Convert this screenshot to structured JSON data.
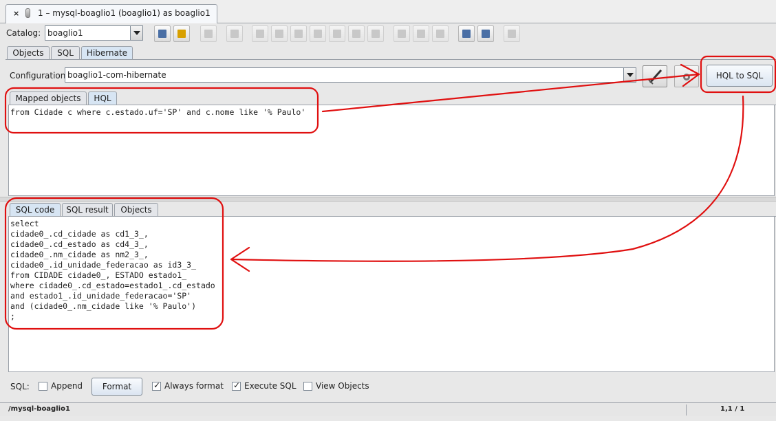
{
  "window": {
    "tab_title": "1 – mysql-boaglio1 (boaglio1) as boaglio1",
    "close_glyph": "×"
  },
  "toolbar": {
    "catalog_label": "Catalog:",
    "catalog_value": "boaglio1"
  },
  "main_tabs": [
    {
      "label": "Objects",
      "selected": false
    },
    {
      "label": "SQL",
      "selected": false
    },
    {
      "label": "Hibernate",
      "selected": true
    }
  ],
  "config": {
    "label": "Configuration",
    "value": "boaglio1-com-hibernate",
    "hql_to_sql_label": "HQL to SQL"
  },
  "hql_tabs": [
    {
      "label": "Mapped objects",
      "selected": false
    },
    {
      "label": "HQL",
      "selected": true
    }
  ],
  "hql_query": "from Cidade c where c.estado.uf='SP' and c.nome like '% Paulo'",
  "sql_tabs": [
    {
      "label": "SQL code",
      "selected": true
    },
    {
      "label": "SQL result",
      "selected": false
    },
    {
      "label": "Objects",
      "selected": false
    }
  ],
  "sql_code": [
    "select",
    "cidade0_.cd_cidade as cd1_3_,",
    "cidade0_.cd_estado as cd4_3_,",
    "cidade0_.nm_cidade as nm2_3_,",
    "cidade0_.id_unidade_federacao as id3_3_",
    "from CIDADE cidade0_, ESTADO estado1_",
    "where cidade0_.cd_estado=estado1_.cd_estado",
    "and estado1_.id_unidade_federacao='SP'",
    "and (cidade0_.nm_cidade like '% Paulo')",
    ";"
  ],
  "options": {
    "sql_label": "SQL:",
    "append": {
      "label": "Append",
      "checked": false
    },
    "format_label": "Format",
    "always_format": {
      "label": "Always format",
      "checked": true
    },
    "execute_sql": {
      "label": "Execute SQL",
      "checked": true
    },
    "view_objects": {
      "label": "View Objects",
      "checked": false
    }
  },
  "status": {
    "connection": "/mysql-boaglio1",
    "position": "1,1 / 1"
  },
  "colors": {
    "annotation_red": "#e01010",
    "selected_tab": "#d7e5f3"
  },
  "icons": {
    "brush": "brush-icon",
    "gear": "gear-icon",
    "database": "database-icon"
  }
}
